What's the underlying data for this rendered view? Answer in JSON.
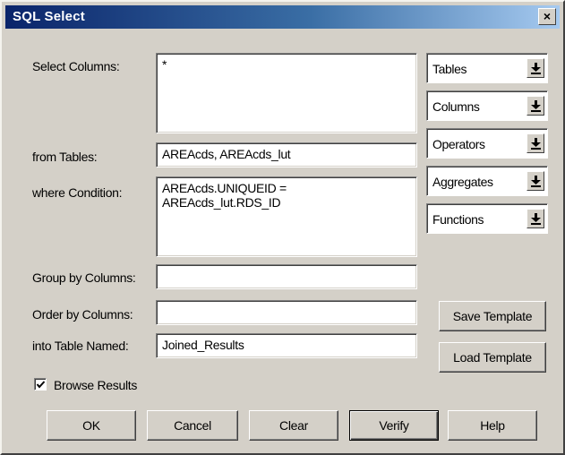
{
  "window": {
    "title": "SQL Select",
    "close_glyph": "×"
  },
  "labels": {
    "select_columns": "Select Columns:",
    "from_tables": "from Tables:",
    "where_condition": "where Condition:",
    "group_by": "Group by Columns:",
    "order_by": "Order by Columns:",
    "into_table": "into Table Named:"
  },
  "fields": {
    "select_columns": "*",
    "from_tables": "AREAcds, AREAcds_lut",
    "where_condition": "AREAcds.UNIQUEID =\nAREAcds_lut.RDS_ID",
    "group_by": "",
    "order_by": "",
    "into_table": "Joined_Results"
  },
  "dropdowns": [
    "Tables",
    "Columns",
    "Operators",
    "Aggregates",
    "Functions"
  ],
  "checkbox": {
    "label": "Browse Results",
    "checked": true
  },
  "side_buttons": {
    "save_template": "Save Template",
    "load_template": "Load Template"
  },
  "buttons": {
    "ok": "OK",
    "cancel": "Cancel",
    "clear": "Clear",
    "verify": "Verify",
    "help": "Help"
  },
  "colors": {
    "face": "#d4d0c8",
    "title_start": "#0a246a",
    "title_end": "#a6caf0"
  },
  "icons": {
    "dropdown_arrow": "arrow-down-bar-icon",
    "check": "checkmark-icon",
    "close": "close-icon"
  }
}
